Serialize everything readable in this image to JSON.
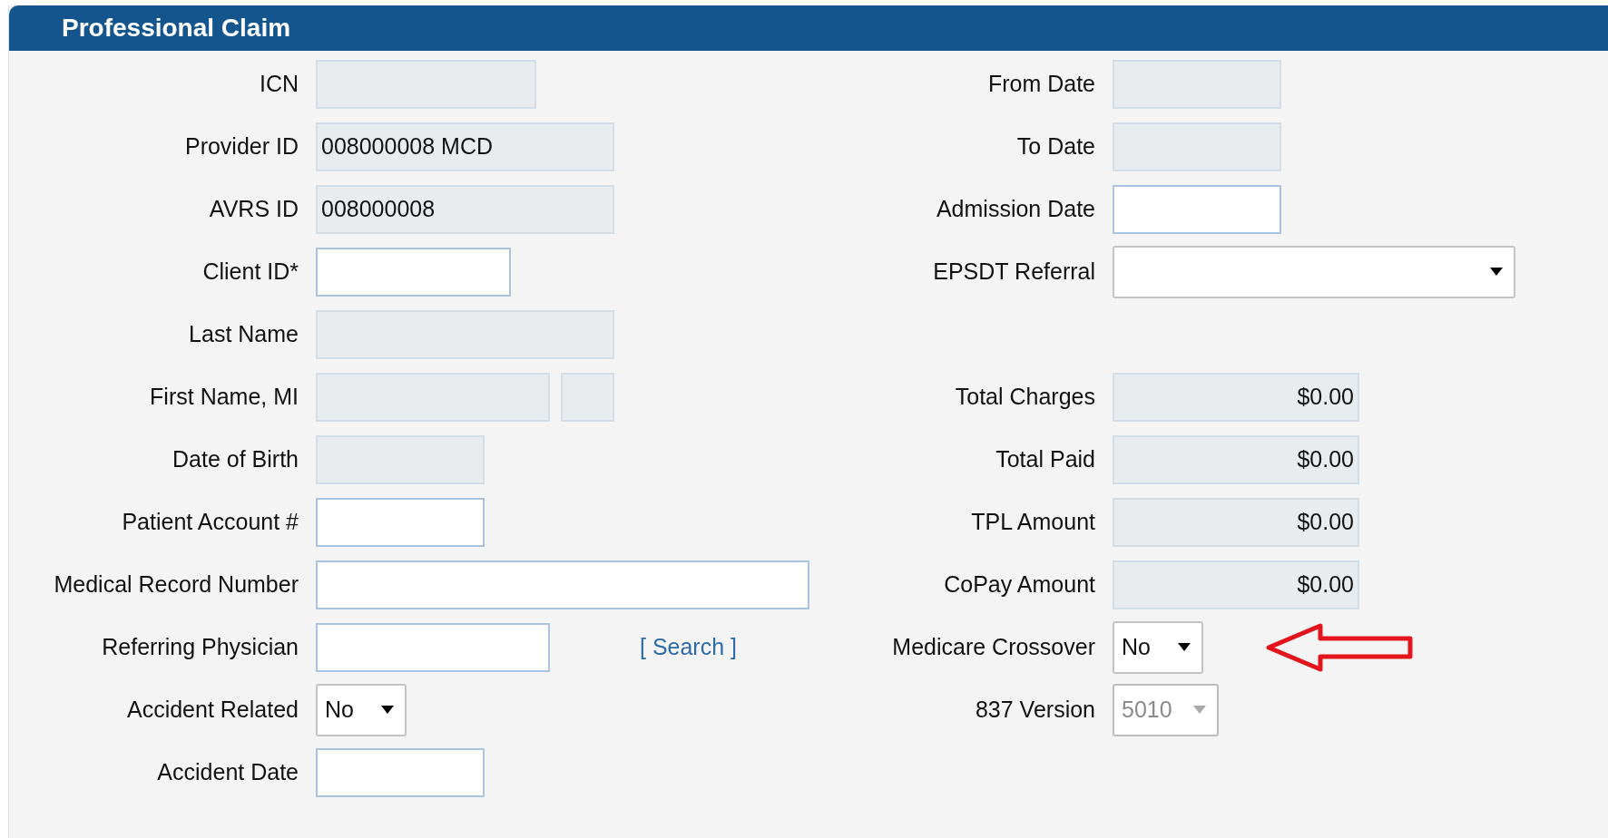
{
  "panel": {
    "title": "Professional Claim"
  },
  "rows": [
    {
      "left": {
        "label": "ICN",
        "kind": "text",
        "readonly": true
      },
      "right": {
        "label": "From Date",
        "kind": "text",
        "readonly": true
      }
    },
    {
      "left": {
        "label": "Provider ID",
        "kind": "text",
        "value": "008000008 MCD",
        "readonly": true
      },
      "right": {
        "label": "To Date",
        "kind": "text",
        "readonly": true
      }
    },
    {
      "left": {
        "label": "AVRS ID",
        "kind": "text",
        "value": "008000008",
        "readonly": true
      },
      "right": {
        "label": "Admission Date",
        "kind": "text",
        "readonly": false
      }
    },
    {
      "left": {
        "label": "Client ID*",
        "kind": "text",
        "readonly": false
      },
      "right": {
        "label": "EPSDT Referral",
        "kind": "select",
        "disabled": false
      }
    },
    {
      "left": {
        "label": "Last Name",
        "kind": "text",
        "readonly": true
      },
      "right": null
    },
    {
      "left": {
        "label": "First Name, MI",
        "kind": "pair",
        "readonly": true
      },
      "right": {
        "label": "Total Charges",
        "kind": "amount",
        "value": "$0.00",
        "readonly": true
      }
    },
    {
      "left": {
        "label": "Date of Birth",
        "kind": "text",
        "readonly": true
      },
      "right": {
        "label": "Total Paid",
        "kind": "amount",
        "value": "$0.00",
        "readonly": true
      }
    },
    {
      "left": {
        "label": "Patient Account #",
        "kind": "text",
        "readonly": false
      },
      "right": {
        "label": "TPL Amount",
        "kind": "amount",
        "value": "$0.00",
        "readonly": true
      }
    },
    {
      "left": {
        "label": "Medical Record Number",
        "kind": "text",
        "readonly": false
      },
      "right": {
        "label": "CoPay Amount",
        "kind": "amount",
        "value": "$0.00",
        "readonly": true
      }
    },
    {
      "left": {
        "label": "Referring Physician",
        "kind": "text",
        "readonly": false,
        "link": "[ Search ]"
      },
      "right": {
        "label": "Medicare Crossover",
        "kind": "select",
        "value": "No",
        "disabled": false,
        "highlighted": true
      }
    },
    {
      "left": {
        "label": "Accident Related",
        "kind": "select",
        "value": "No",
        "disabled": false
      },
      "right": {
        "label": "837 Version",
        "kind": "select",
        "value": "5010",
        "disabled": true
      }
    },
    {
      "left": {
        "label": "Accident Date",
        "kind": "text",
        "readonly": false
      },
      "right": null
    }
  ]
}
